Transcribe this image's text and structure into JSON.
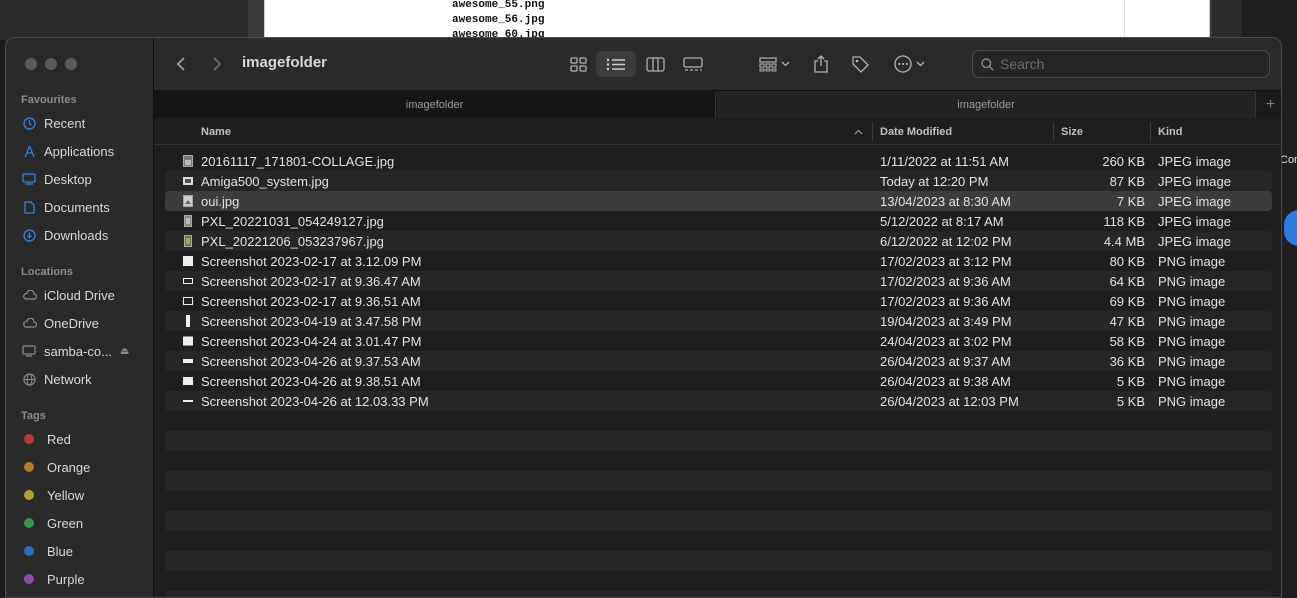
{
  "background": {
    "doc_lines": [
      "awesome_55.png",
      "awesome_56.jpg",
      "awesome_60.jpg"
    ],
    "right_text": "Cor"
  },
  "window": {
    "title": "imagefolder",
    "search_placeholder": "Search",
    "tabs": [
      {
        "label": "imagefolder"
      },
      {
        "label": "imagefolder"
      }
    ],
    "tab_add": "+"
  },
  "sidebar": {
    "favourites_label": "Favourites",
    "favourites": [
      {
        "label": "Recent",
        "icon": "clock-icon"
      },
      {
        "label": "Applications",
        "icon": "applications-icon"
      },
      {
        "label": "Desktop",
        "icon": "desktop-icon"
      },
      {
        "label": "Documents",
        "icon": "document-icon"
      },
      {
        "label": "Downloads",
        "icon": "download-icon"
      }
    ],
    "locations_label": "Locations",
    "locations": [
      {
        "label": "iCloud Drive",
        "icon": "cloud-icon"
      },
      {
        "label": "OneDrive",
        "icon": "cloud-icon"
      },
      {
        "label": "samba-co...",
        "icon": "display-icon"
      },
      {
        "label": "Network",
        "icon": "globe-icon"
      }
    ],
    "tags_label": "Tags",
    "tags": [
      {
        "label": "Red",
        "color": "#e0443e"
      },
      {
        "label": "Orange",
        "color": "#e0912b"
      },
      {
        "label": "Yellow",
        "color": "#d9c030"
      },
      {
        "label": "Green",
        "color": "#3fb54e"
      },
      {
        "label": "Blue",
        "color": "#2f7ce0"
      },
      {
        "label": "Purple",
        "color": "#a456c5"
      }
    ]
  },
  "columns": {
    "name": "Name",
    "date": "Date Modified",
    "size": "Size",
    "kind": "Kind"
  },
  "files": [
    {
      "name": "20161117_171801-COLLAGE.jpg",
      "date": "1/11/2022 at 11:51 AM",
      "size": "260 KB",
      "kind": "JPEG image"
    },
    {
      "name": "Amiga500_system.jpg",
      "date": "Today at 12:20 PM",
      "size": "87 KB",
      "kind": "JPEG image"
    },
    {
      "name": "oui.jpg",
      "date": "13/04/2023 at 8:30 AM",
      "size": "7 KB",
      "kind": "JPEG image"
    },
    {
      "name": "PXL_20221031_054249127.jpg",
      "date": "5/12/2022 at 8:17 AM",
      "size": "118 KB",
      "kind": "JPEG image"
    },
    {
      "name": "PXL_20221206_053237967.jpg",
      "date": "6/12/2022 at 12:02 PM",
      "size": "4.4 MB",
      "kind": "JPEG image"
    },
    {
      "name": "Screenshot 2023-02-17 at 3.12.09 PM",
      "date": "17/02/2023 at 3:12 PM",
      "size": "80 KB",
      "kind": "PNG image"
    },
    {
      "name": "Screenshot 2023-02-17 at 9.36.47 AM",
      "date": "17/02/2023 at 9:36 AM",
      "size": "64 KB",
      "kind": "PNG image"
    },
    {
      "name": "Screenshot 2023-02-17 at 9.36.51 AM",
      "date": "17/02/2023 at 9:36 AM",
      "size": "69 KB",
      "kind": "PNG image"
    },
    {
      "name": "Screenshot 2023-04-19 at 3.47.58 PM",
      "date": "19/04/2023 at 3:49 PM",
      "size": "47 KB",
      "kind": "PNG image"
    },
    {
      "name": "Screenshot 2023-04-24 at 3.01.47 PM",
      "date": "24/04/2023 at 3:02 PM",
      "size": "58 KB",
      "kind": "PNG image"
    },
    {
      "name": "Screenshot 2023-04-26 at 9.37.53 AM",
      "date": "26/04/2023 at 9:37 AM",
      "size": "36 KB",
      "kind": "PNG image"
    },
    {
      "name": "Screenshot 2023-04-26 at 9.38.51 AM",
      "date": "26/04/2023 at 9:38 AM",
      "size": "5 KB",
      "kind": "PNG image"
    },
    {
      "name": "Screenshot 2023-04-26 at 12.03.33 PM",
      "date": "26/04/2023 at 12:03 PM",
      "size": "5 KB",
      "kind": "PNG image"
    }
  ],
  "selected_file": "oui.jpg"
}
